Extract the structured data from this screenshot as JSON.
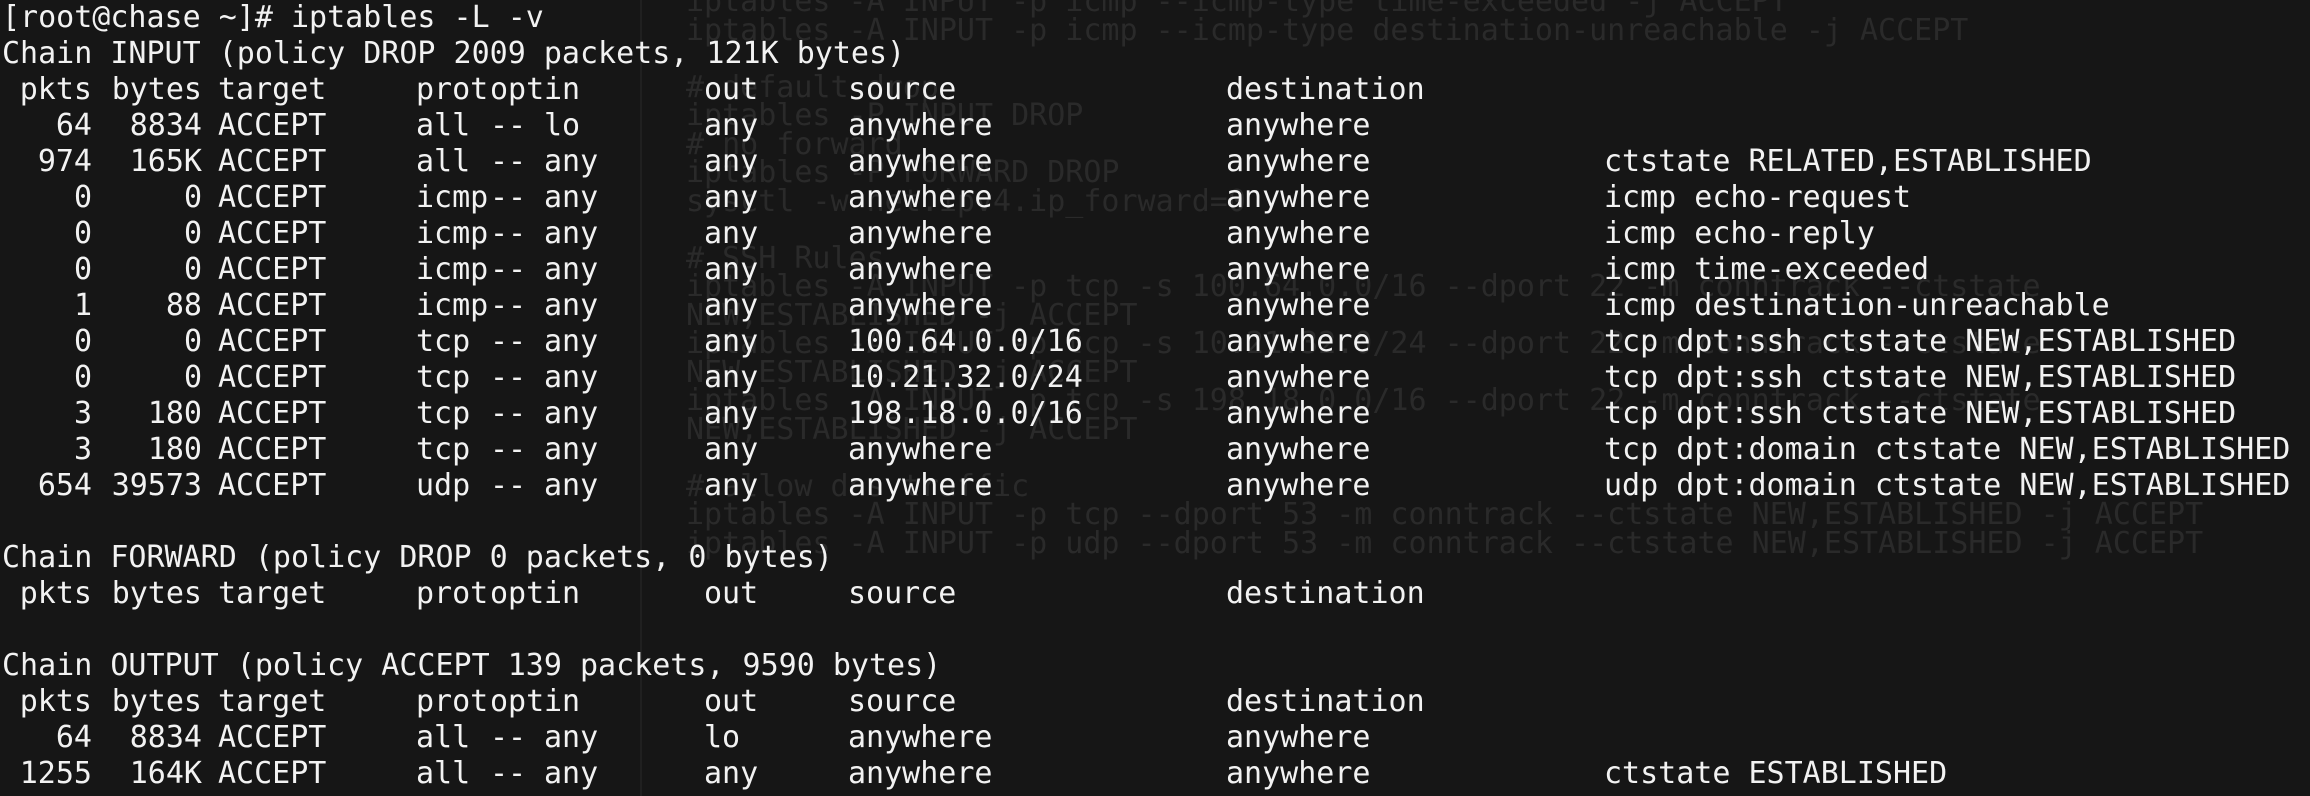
{
  "background": "#161616",
  "foreground": "#f2f2f2",
  "prompt": "[root@chase ~]# iptables -L -v",
  "background_script_lines": [
    "iptables -A INPUT -p icmp --icmp-type time-exceeded -j ACCEPT",
    "iptables -A INPUT -p icmp --icmp-type destination-unreachable -j ACCEPT",
    "",
    "# default drop",
    "iptables -P INPUT DROP",
    "# no forward",
    "iptables -P FORWARD DROP",
    "sysctl -w net.ipv4.ip_forward=0",
    "",
    "# SSH Rules",
    "iptables -A INPUT -p tcp -s 100.64.0.0/16 --dport 22 -m conntrack --ctstate",
    "NEW,ESTABLISHED -j ACCEPT",
    "iptables -A INPUT -p tcp -s 10.21.32.0/24 --dport 22 -m conntrack --ctstate",
    "NEW,ESTABLISHED -j ACCEPT",
    "iptables -A INPUT -p tcp -s 198.18.0.0/16 --dport 22 -m conntrack --ctstate",
    "NEW,ESTABLISHED -j ACCEPT",
    "",
    "# allow dns traffic",
    "iptables -A INPUT -p tcp --dport 53 -m conntrack --ctstate NEW,ESTABLISHED -j ACCEPT",
    "iptables -A INPUT -p udp --dport 53 -m conntrack --ctstate NEW,ESTABLISHED -j ACCEPT"
  ],
  "header": {
    "pkts": "pkts",
    "bytes": "bytes",
    "target": "target",
    "prot": "prot",
    "opt": "opt",
    "in": "in",
    "out": "out",
    "source": "source",
    "destination": "destination"
  },
  "chains": [
    {
      "title": "Chain INPUT (policy DROP 2009 packets, 121K bytes)",
      "rules": [
        {
          "pkts": "64",
          "bytes": "8834",
          "target": "ACCEPT",
          "prot": "all",
          "opt": "--",
          "in": "lo",
          "out": "any",
          "source": "anywhere",
          "destination": "anywhere",
          "extra": ""
        },
        {
          "pkts": "974",
          "bytes": "165K",
          "target": "ACCEPT",
          "prot": "all",
          "opt": "--",
          "in": "any",
          "out": "any",
          "source": "anywhere",
          "destination": "anywhere",
          "extra": "ctstate RELATED,ESTABLISHED"
        },
        {
          "pkts": "0",
          "bytes": "0",
          "target": "ACCEPT",
          "prot": "icmp",
          "opt": "--",
          "in": "any",
          "out": "any",
          "source": "anywhere",
          "destination": "anywhere",
          "extra": "icmp echo-request"
        },
        {
          "pkts": "0",
          "bytes": "0",
          "target": "ACCEPT",
          "prot": "icmp",
          "opt": "--",
          "in": "any",
          "out": "any",
          "source": "anywhere",
          "destination": "anywhere",
          "extra": "icmp echo-reply"
        },
        {
          "pkts": "0",
          "bytes": "0",
          "target": "ACCEPT",
          "prot": "icmp",
          "opt": "--",
          "in": "any",
          "out": "any",
          "source": "anywhere",
          "destination": "anywhere",
          "extra": "icmp time-exceeded"
        },
        {
          "pkts": "1",
          "bytes": "88",
          "target": "ACCEPT",
          "prot": "icmp",
          "opt": "--",
          "in": "any",
          "out": "any",
          "source": "anywhere",
          "destination": "anywhere",
          "extra": "icmp destination-unreachable"
        },
        {
          "pkts": "0",
          "bytes": "0",
          "target": "ACCEPT",
          "prot": "tcp",
          "opt": "--",
          "in": "any",
          "out": "any",
          "source": "100.64.0.0/16",
          "destination": "anywhere",
          "extra": "tcp dpt:ssh ctstate NEW,ESTABLISHED"
        },
        {
          "pkts": "0",
          "bytes": "0",
          "target": "ACCEPT",
          "prot": "tcp",
          "opt": "--",
          "in": "any",
          "out": "any",
          "source": "10.21.32.0/24",
          "destination": "anywhere",
          "extra": "tcp dpt:ssh ctstate NEW,ESTABLISHED"
        },
        {
          "pkts": "3",
          "bytes": "180",
          "target": "ACCEPT",
          "prot": "tcp",
          "opt": "--",
          "in": "any",
          "out": "any",
          "source": "198.18.0.0/16",
          "destination": "anywhere",
          "extra": "tcp dpt:ssh ctstate NEW,ESTABLISHED"
        },
        {
          "pkts": "3",
          "bytes": "180",
          "target": "ACCEPT",
          "prot": "tcp",
          "opt": "--",
          "in": "any",
          "out": "any",
          "source": "anywhere",
          "destination": "anywhere",
          "extra": "tcp dpt:domain ctstate NEW,ESTABLISHED"
        },
        {
          "pkts": "654",
          "bytes": "39573",
          "target": "ACCEPT",
          "prot": "udp",
          "opt": "--",
          "in": "any",
          "out": "any",
          "source": "anywhere",
          "destination": "anywhere",
          "extra": "udp dpt:domain ctstate NEW,ESTABLISHED"
        }
      ]
    },
    {
      "title": "Chain FORWARD (policy DROP 0 packets, 0 bytes)",
      "rules": []
    },
    {
      "title": "Chain OUTPUT (policy ACCEPT 139 packets, 9590 bytes)",
      "rules": [
        {
          "pkts": "64",
          "bytes": "8834",
          "target": "ACCEPT",
          "prot": "all",
          "opt": "--",
          "in": "any",
          "out": "lo",
          "source": "anywhere",
          "destination": "anywhere",
          "extra": ""
        },
        {
          "pkts": "1255",
          "bytes": "164K",
          "target": "ACCEPT",
          "prot": "all",
          "opt": "--",
          "in": "any",
          "out": "any",
          "source": "anywhere",
          "destination": "anywhere",
          "extra": "ctstate ESTABLISHED"
        }
      ]
    }
  ]
}
